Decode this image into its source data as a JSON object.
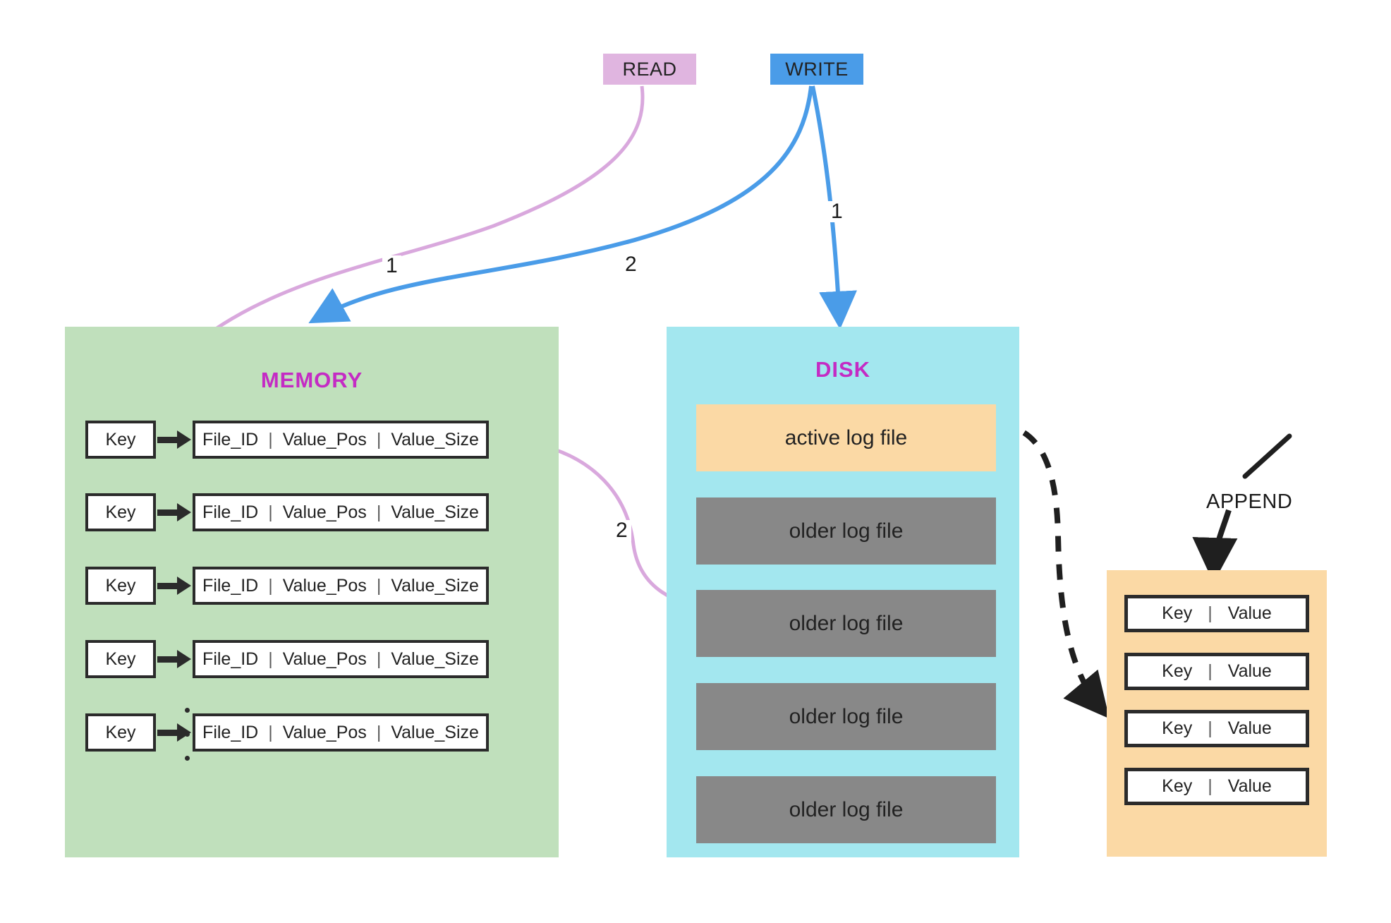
{
  "operations": [
    {
      "id": "read",
      "label": "READ",
      "color": "#e0b5e0"
    },
    {
      "id": "write",
      "label": "WRITE",
      "color": "#4a9ce8"
    }
  ],
  "memory": {
    "title": "MEMORY",
    "background": "#c0e0bc",
    "title_color": "#c42bc4",
    "rows": [
      {
        "key": "Key",
        "file_id": "File_ID",
        "value_pos": "Value_Pos",
        "value_size": "Value_Size"
      },
      {
        "key": "Key",
        "file_id": "File_ID",
        "value_pos": "Value_Pos",
        "value_size": "Value_Size"
      },
      {
        "key": "Key",
        "file_id": "File_ID",
        "value_pos": "Value_Pos",
        "value_size": "Value_Size"
      },
      {
        "key": "Key",
        "file_id": "File_ID",
        "value_pos": "Value_Pos",
        "value_size": "Value_Size"
      },
      {
        "key": "Key",
        "file_id": "File_ID",
        "value_pos": "Value_Pos",
        "value_size": "Value_Size"
      }
    ],
    "separator": "|",
    "ellipsis": "vertical-ellipsis"
  },
  "disk": {
    "title": "DISK",
    "background": "#a3e7ef",
    "title_color": "#c42bc4",
    "files": [
      {
        "label": "active log file",
        "state": "active",
        "color": "#fbd9a5"
      },
      {
        "label": "older log file",
        "state": "older",
        "color": "#888888"
      },
      {
        "label": "older log file",
        "state": "older",
        "color": "#888888"
      },
      {
        "label": "older log file",
        "state": "older",
        "color": "#888888"
      },
      {
        "label": "older log file",
        "state": "older",
        "color": "#888888"
      }
    ]
  },
  "append": {
    "label": "APPEND",
    "background": "#fbd9a5",
    "separator": "|",
    "records": [
      {
        "key": "Key",
        "value": "Value"
      },
      {
        "key": "Key",
        "value": "Value"
      },
      {
        "key": "Key",
        "value": "Value"
      },
      {
        "key": "Key",
        "value": "Value"
      }
    ]
  },
  "edges": {
    "read_to_memory": "1",
    "write_to_memory": "2",
    "write_to_disk": "1",
    "memory_to_disk": "2"
  }
}
